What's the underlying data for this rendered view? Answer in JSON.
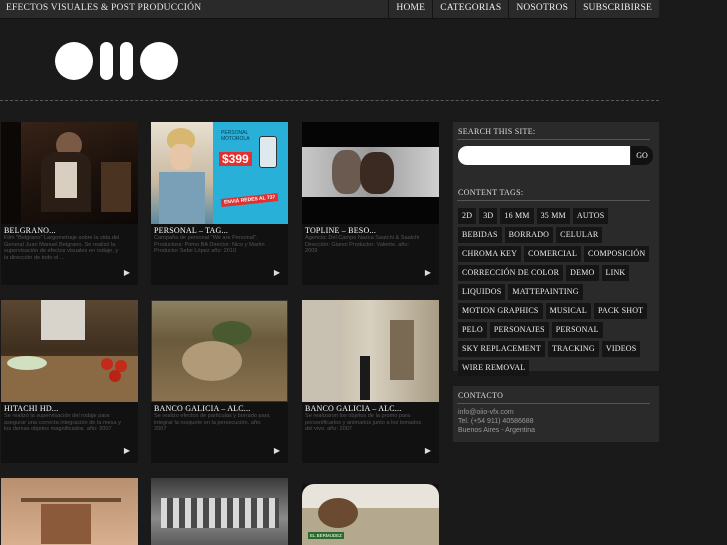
{
  "header": {
    "site_title": "EFECTOS VISUALES & POST PRODUCCIÓN",
    "nav": [
      "HOME",
      "CATEGORIAS",
      "NOSOTROS",
      "SUBSCRIBIRSE"
    ]
  },
  "cards": [
    {
      "title": "BELGRANO...",
      "desc": "Film \"Belgrano\" Largometraje sobre la vida del General Juan Manuel Belgrano. Se realizó la supervisación de efectos visuales en rodaje, y la dirección de todo el ..."
    },
    {
      "title": "PERSONAL – TAG...",
      "desc": "Campaña de personal \"We are Personal\". Productora: Primo BA Director: Nico y Martin Productor Sebe López año: 2010"
    },
    {
      "title": "TOPLINE – BESO...",
      "desc": "Agencia: Del Campo Nazca Saatchi & Saatchi Dirección: Gianni Productor: Valente. año: 2009"
    },
    {
      "title": "HITACHI HD...",
      "desc": "Se realizó la supervisación del rodaje para asegurar una correcta integración de la mesa y los demas objetos magnificados. año: 2007"
    },
    {
      "title": "BANCO GALICIA – ALC...",
      "desc": "Se realizo efectos de particulas y borrado para integrar la rosquete en la persecución. año: 2007"
    },
    {
      "title": "BANCO GALICIA – ALC...",
      "desc": "Se realizaron los objetos de la promo para personificarlos y animarlos junto a los tomados del vivo. año: 2007"
    }
  ],
  "sidebar": {
    "search_heading": "SEARCH THIS SITE:",
    "search_button": "GO",
    "tags_heading": "CONTENT TAGS:",
    "tags": [
      "2D",
      "3D",
      "16 MM",
      "35 MM",
      "AUTOS",
      "BEBIDAS",
      "BORRADO",
      "CELULAR",
      "CHROMA KEY",
      "COMERCIAL",
      "COMPOSICIÓN",
      "CORRECCIÓN DE COLOR",
      "DEMO",
      "LINK",
      "LIQUIDOS",
      "MATTEPAINTING",
      "MOTION GRAPHICS",
      "MUSICAL",
      "PACK SHOT",
      "PELO",
      "PERSONAJES",
      "PERSONAL",
      "SKY REPLACEMENT",
      "TRACKING",
      "VIDEOS",
      "WIRE REMOVAL"
    ],
    "contact_heading": "CONTACTO",
    "contact_email": "info@oiio-vfx.com",
    "contact_phone": "Tel. (+54 911) 40586688",
    "contact_city": "Buenos Aires - Argentina"
  },
  "thumbnail_text": {
    "personal_brand": "PERSONAL",
    "personal_phone": "MOTOROLA",
    "personal_price": "$399",
    "personal_cta": "ENVIÁ REDES AL 737",
    "galicia_sign": "EL BERMUDEZ"
  },
  "icons": {
    "play": "play-icon",
    "logo": "oiio-logo"
  },
  "colors": {
    "background": "#1a1a1a",
    "bar": "#2a2a2a",
    "tag": "#151515",
    "accent_personal": "#29b0d8"
  }
}
